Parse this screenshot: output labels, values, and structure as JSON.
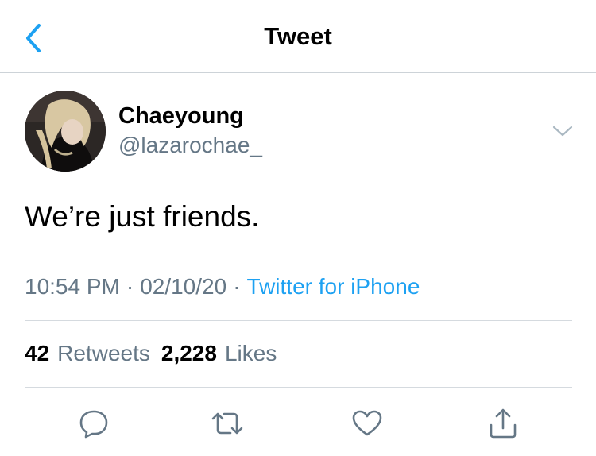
{
  "nav": {
    "title": "Tweet",
    "back_icon": "chevron-left-icon"
  },
  "author": {
    "display_name": "Chaeyoung",
    "handle": "@lazarochae_",
    "avatar": "avatar"
  },
  "tweet": {
    "text": "We’re just friends.",
    "time": "10:54 PM",
    "date": "02/10/20",
    "separator": "·",
    "source": "Twitter for iPhone"
  },
  "stats": {
    "retweets_count": "42",
    "retweets_label": "Retweets",
    "likes_count": "2,228",
    "likes_label": "Likes"
  },
  "actions": [
    "reply-icon",
    "retweet-icon",
    "like-icon",
    "share-icon"
  ],
  "colors": {
    "accent": "#1da1f2",
    "secondary_text": "#657786",
    "icon": "#657786",
    "divider": "#d5dadf"
  }
}
